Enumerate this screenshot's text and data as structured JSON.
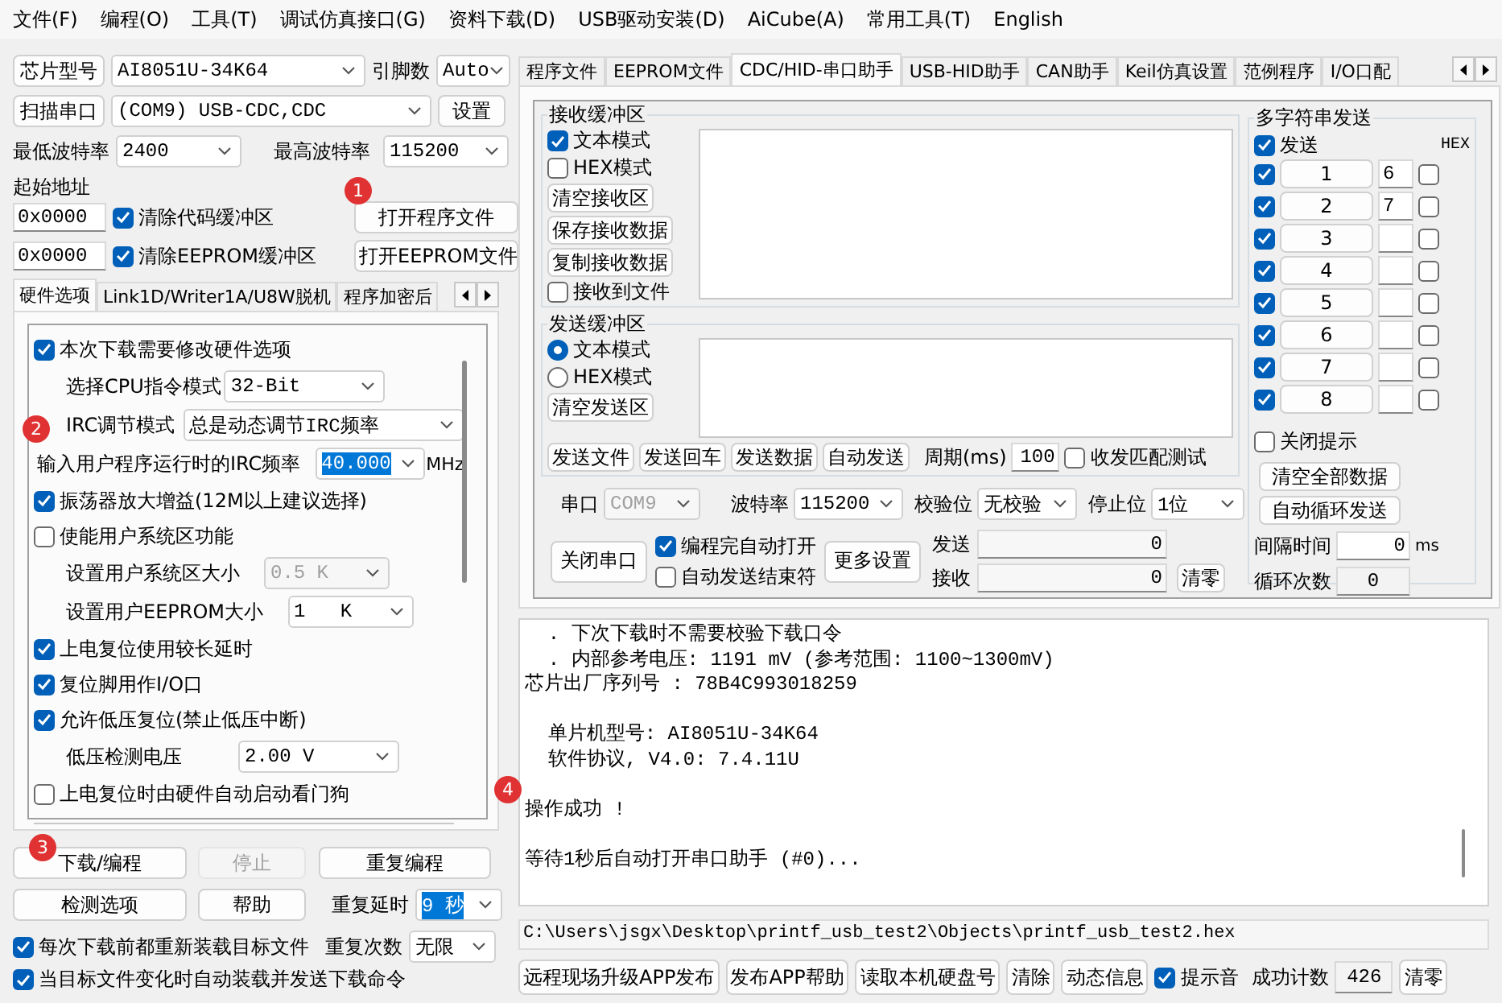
{
  "menu_bar": [
    {
      "label": "文件(F)"
    },
    {
      "label": "编程(O)"
    },
    {
      "label": "工具(T)"
    },
    {
      "label": "调试仿真接口(G)"
    },
    {
      "label": "资料下载(D)"
    },
    {
      "label": "USB驱动安装(D)"
    },
    {
      "label": "AiCube(A)"
    },
    {
      "label": "常用工具(T)"
    },
    {
      "label": "English"
    }
  ],
  "chip_settings": [
    [
      {
        "kind": "button",
        "text": "芯片型号"
      },
      {
        "kind": "combo",
        "value": "AI8051U-34K64"
      },
      {
        "kind": "label",
        "text": "引脚数"
      },
      {
        "kind": "combo",
        "value": "Auto"
      }
    ],
    [
      {
        "kind": "button",
        "text": "扫描串口"
      },
      {
        "kind": "combo",
        "value": "(COM9) USB-CDC,CDC"
      },
      {
        "kind": "button",
        "text": "设置"
      }
    ],
    [
      {
        "kind": "label",
        "text": "最低波特率"
      },
      {
        "kind": "combo",
        "value": "2400"
      },
      {
        "kind": "label",
        "text": "最高波特率"
      },
      {
        "kind": "combo",
        "value": "115200"
      }
    ],
    [
      {
        "kind": "label",
        "text": "起始地址"
      }
    ],
    [
      {
        "kind": "field",
        "value": "0x0000"
      },
      {
        "kind": "checkbox",
        "text": "清除代码缓冲区",
        "checked": true
      },
      {
        "kind": "button",
        "text": "打开程序文件"
      }
    ],
    [
      {
        "kind": "field",
        "value": "0x0000"
      },
      {
        "kind": "checkbox",
        "text": "清除EEPROM缓冲区",
        "checked": true
      },
      {
        "kind": "button",
        "text": "打开EEPROM文件"
      }
    ]
  ],
  "left_tabs": [
    {
      "label": "硬件选项",
      "selected": true
    },
    {
      "label": "Link1D/Writer1A/U8W脱机",
      "selected": false
    },
    {
      "label": "程序加密后",
      "selected": false
    }
  ],
  "hardware_options": [
    {
      "kind": "checkbox",
      "text": "本次下载需要修改硬件选项",
      "checked": true
    },
    {
      "kind": "setting",
      "label": "选择CPU指令模式",
      "value": "32-Bit",
      "disabled": false,
      "highlighted": false
    },
    {
      "kind": "setting",
      "label": "IRC调节模式",
      "value": "总是动态调节IRC频率",
      "disabled": false,
      "highlighted": false
    },
    {
      "kind": "setting",
      "label": "输入用户程序运行时的IRC频率",
      "value": "40.000",
      "unit": "MHz",
      "disabled": false,
      "highlighted": true
    },
    {
      "kind": "checkbox",
      "text": "振荡器放大增益(12M以上建议选择)",
      "checked": true
    },
    {
      "kind": "checkbox",
      "text": "使能用户系统区功能",
      "checked": false
    },
    {
      "kind": "setting",
      "label": "设置用户系统区大小",
      "value": "0.5 K",
      "disabled": true,
      "highlighted": false
    },
    {
      "kind": "setting",
      "label": "设置用户EEPROM大小",
      "value": "1   K",
      "disabled": false,
      "highlighted": false
    },
    {
      "kind": "checkbox",
      "text": "上电复位使用较长延时",
      "checked": true
    },
    {
      "kind": "checkbox",
      "text": "复位脚用作I/O口",
      "checked": true
    },
    {
      "kind": "checkbox",
      "text": "允许低压复位(禁止低压中断)",
      "checked": true
    },
    {
      "kind": "setting",
      "label": "低压检测电压",
      "value": "2.00 V",
      "disabled": false,
      "highlighted": false
    },
    {
      "kind": "checkbox",
      "text": "上电复位时由硬件自动启动看门狗",
      "checked": false
    }
  ],
  "program_actions": [
    [
      {
        "kind": "button",
        "text": "下载/编程",
        "disabled": false
      },
      {
        "kind": "button",
        "text": "停止",
        "disabled": true
      },
      {
        "kind": "button",
        "text": "重复编程",
        "disabled": false
      }
    ],
    [
      {
        "kind": "button",
        "text": "检测选项"
      },
      {
        "kind": "button",
        "text": "帮助"
      },
      {
        "kind": "label",
        "text": "重复延时"
      },
      {
        "kind": "combo",
        "value": "9 秒",
        "highlighted": true
      }
    ],
    [
      {
        "kind": "checkbox",
        "text": "每次下载前都重新装载目标文件",
        "checked": true
      },
      {
        "kind": "label",
        "text": "重复次数"
      },
      {
        "kind": "combo",
        "value": "无限",
        "highlighted": false
      }
    ],
    [
      {
        "kind": "checkbox",
        "text": "当目标文件变化时自动装载并发送下载命令",
        "checked": true
      }
    ]
  ],
  "right_tabs": [
    {
      "label": "程序文件",
      "selected": false
    },
    {
      "label": "EEPROM文件",
      "selected": false
    },
    {
      "label": "CDC/HID-串口助手",
      "selected": true
    },
    {
      "label": "USB-HID助手",
      "selected": false
    },
    {
      "label": "CAN助手",
      "selected": false
    },
    {
      "label": "Keil仿真设置",
      "selected": false
    },
    {
      "label": "范例程序",
      "selected": false
    },
    {
      "label": "I/O口配",
      "selected": false
    }
  ],
  "receive_buffer": {
    "title": "接收缓冲区",
    "controls": [
      {
        "kind": "checkbox",
        "text": "文本模式",
        "checked": true
      },
      {
        "kind": "checkbox",
        "text": "HEX模式",
        "checked": false
      },
      {
        "kind": "button",
        "text": "清空接收区"
      },
      {
        "kind": "button",
        "text": "保存接收数据"
      },
      {
        "kind": "button",
        "text": "复制接收数据"
      },
      {
        "kind": "checkbox",
        "text": "接收到文件",
        "checked": false
      }
    ]
  },
  "send_buffer": {
    "title": "发送缓冲区",
    "controls": [
      {
        "kind": "radio",
        "text": "文本模式",
        "selected": true
      },
      {
        "kind": "radio",
        "text": "HEX模式",
        "selected": false
      },
      {
        "kind": "button",
        "text": "清空发送区"
      }
    ],
    "actions": [
      {
        "kind": "button",
        "text": "发送文件"
      },
      {
        "kind": "button",
        "text": "发送回车"
      },
      {
        "kind": "button",
        "text": "发送数据"
      },
      {
        "kind": "button",
        "text": "自动发送"
      },
      {
        "kind": "label",
        "text": "周期(ms)"
      },
      {
        "kind": "field",
        "value": "100"
      },
      {
        "kind": "checkbox",
        "text": "收发匹配测试",
        "checked": false
      }
    ]
  },
  "serial_settings": [
    {
      "kind": "label",
      "text": "串口"
    },
    {
      "kind": "combo",
      "value": "COM9",
      "disabled": true
    },
    {
      "kind": "label",
      "text": "波特率"
    },
    {
      "kind": "combo",
      "value": "115200",
      "disabled": false
    },
    {
      "kind": "label",
      "text": "校验位"
    },
    {
      "kind": "combo",
      "value": "无校验",
      "disabled": false
    },
    {
      "kind": "label",
      "text": "停止位"
    },
    {
      "kind": "combo",
      "value": "1位",
      "disabled": false
    }
  ],
  "serial_controls": {
    "close_button": "关闭串口",
    "options": [
      {
        "text": "编程完自动打开",
        "checked": true
      },
      {
        "text": "自动发送结束符",
        "checked": false
      }
    ],
    "more_button": "更多设置",
    "counters": [
      {
        "label": "发送",
        "value": "0"
      },
      {
        "label": "接收",
        "value": "0"
      }
    ],
    "reset_button": "清零"
  },
  "multi_send": {
    "title": "多字符串发送",
    "send_all": {
      "text": "发送",
      "checked": true
    },
    "hex_header": "HEX",
    "rows": [
      {
        "checked": true,
        "label": "1",
        "value": "6",
        "hex": false
      },
      {
        "checked": true,
        "label": "2",
        "value": "7",
        "hex": false
      },
      {
        "checked": true,
        "label": "3",
        "hex": false
      },
      {
        "checked": true,
        "label": "4",
        "hex": false
      },
      {
        "checked": true,
        "label": "5",
        "hex": false
      },
      {
        "checked": true,
        "label": "6",
        "hex": false
      },
      {
        "checked": true,
        "label": "7",
        "hex": false
      },
      {
        "checked": true,
        "label": "8",
        "hex": false
      }
    ],
    "close_hint": {
      "text": "关闭提示",
      "checked": false
    },
    "buttons": [
      "清空全部数据",
      "自动循环发送"
    ],
    "interval": {
      "label": "间隔时间",
      "value": "0",
      "unit": "ms"
    },
    "loop_count": {
      "label": "循环次数",
      "value": "0"
    }
  },
  "log": [
    {
      "lines": [
        "  . 下次下载时不需要校验下载口令",
        "  . 内部参考电压: 1191 mV (参考范围: 1100~1300mV)",
        "芯片出厂序列号 : 78B4C993018259"
      ]
    },
    {
      "lines": [
        "  单片机型号: AI8051U-34K64",
        "  软件协议, V4.0: 7.4.11U"
      ]
    },
    {
      "lines": [
        "操作成功 !"
      ]
    },
    {
      "lines": [
        "等待1秒后自动打开串口助手 (#0)..."
      ]
    }
  ],
  "file_path": "C:\\Users\\jsgx\\Desktop\\printf_usb_test2\\Objects\\printf_usb_test2.hex",
  "bottom_bar": [
    {
      "kind": "button",
      "text": "远程现场升级APP发布"
    },
    {
      "kind": "button",
      "text": "发布APP帮助"
    },
    {
      "kind": "button",
      "text": "读取本机硬盘号"
    },
    {
      "kind": "button",
      "text": "清除"
    },
    {
      "kind": "button",
      "text": "动态信息"
    },
    {
      "kind": "checkbox",
      "text": "提示音",
      "checked": true
    },
    {
      "kind": "label",
      "text": "成功计数"
    },
    {
      "kind": "field",
      "value": "426"
    },
    {
      "kind": "button",
      "text": "清零"
    }
  ],
  "markers": [
    {
      "label": "1"
    },
    {
      "label": "2"
    },
    {
      "label": "3"
    },
    {
      "label": "4"
    }
  ]
}
